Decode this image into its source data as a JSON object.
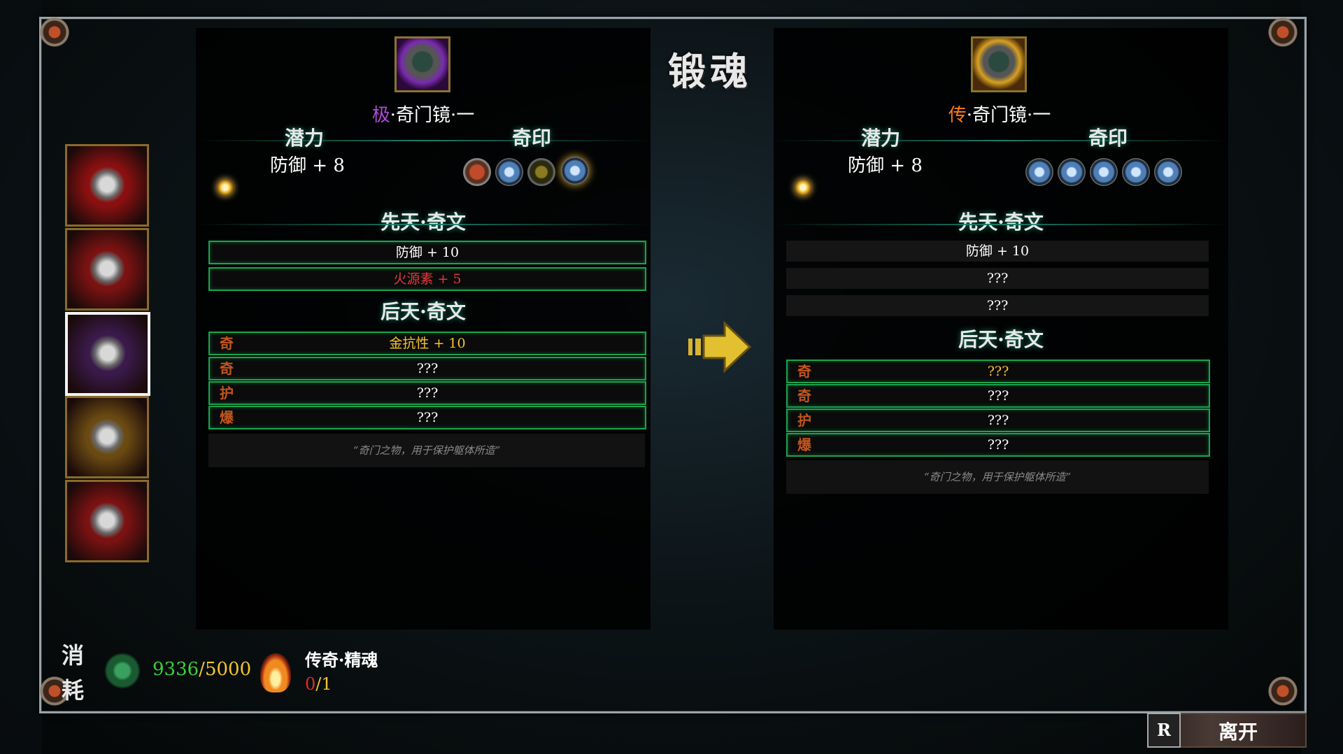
{
  "window": {
    "title": "锻魂"
  },
  "left_item": {
    "name_prefix": "极",
    "name_rest": "·奇门镜·一",
    "prefix_color": "#b04ad6",
    "potential_label": "潜力",
    "potential_value": "防御 + 8",
    "seal_label": "奇印",
    "innate_label": "先天·奇文",
    "innate": [
      {
        "text": "防御 + 10",
        "color": "#ffffff"
      },
      {
        "text": "火源素 + 5",
        "color": "#e23a3a"
      }
    ],
    "acquired_label": "后天·奇文",
    "acquired": [
      {
        "tag": "奇",
        "text": "金抗性 + 10",
        "color": "#f4c430"
      },
      {
        "tag": "奇",
        "text": "???",
        "color": "#ffffff"
      },
      {
        "tag": "护",
        "text": "???",
        "color": "#ffffff"
      },
      {
        "tag": "爆",
        "text": "???",
        "color": "#ffffff"
      }
    ],
    "description": "“奇门之物，用于保护躯体所造”"
  },
  "right_item": {
    "name_prefix": "传",
    "name_rest": "·奇门镜·一",
    "prefix_color": "#ff7a1a",
    "potential_label": "潜力",
    "potential_value": "防御 + 8",
    "seal_label": "奇印",
    "innate_label": "先天·奇文",
    "innate": [
      {
        "text": "防御 + 10",
        "color": "#ffffff"
      },
      {
        "text": "???",
        "color": "#ffffff"
      },
      {
        "text": "???",
        "color": "#ffffff"
      }
    ],
    "acquired_label": "后天·奇文",
    "acquired": [
      {
        "tag": "奇",
        "text": "???",
        "color": "#f4c430"
      },
      {
        "tag": "奇",
        "text": "???",
        "color": "#ffffff"
      },
      {
        "tag": "护",
        "text": "???",
        "color": "#ffffff"
      },
      {
        "tag": "爆",
        "text": "???",
        "color": "#ffffff"
      }
    ],
    "description": "“奇门之物，用于保护躯体所造”"
  },
  "sidebar": {
    "slots": [
      {
        "name": "sword-icon",
        "bg": "#8a1010"
      },
      {
        "name": "mask-icon",
        "bg": "#7a1212"
      },
      {
        "name": "mirror-icon",
        "bg": "#3a1a4a",
        "selected": true
      },
      {
        "name": "boots-icon",
        "bg": "#6a4a12"
      },
      {
        "name": "ring-icon",
        "bg": "#7a1212"
      }
    ]
  },
  "cost": {
    "label_top": "消",
    "label_bottom": "耗",
    "soul_current": "9336",
    "soul_sep": "/",
    "soul_required": "5000",
    "essence_name": "传奇·精魂",
    "essence_current": "0",
    "essence_sep": "/",
    "essence_required": "1"
  },
  "footer": {
    "key": "R",
    "leave_label": "离开"
  }
}
